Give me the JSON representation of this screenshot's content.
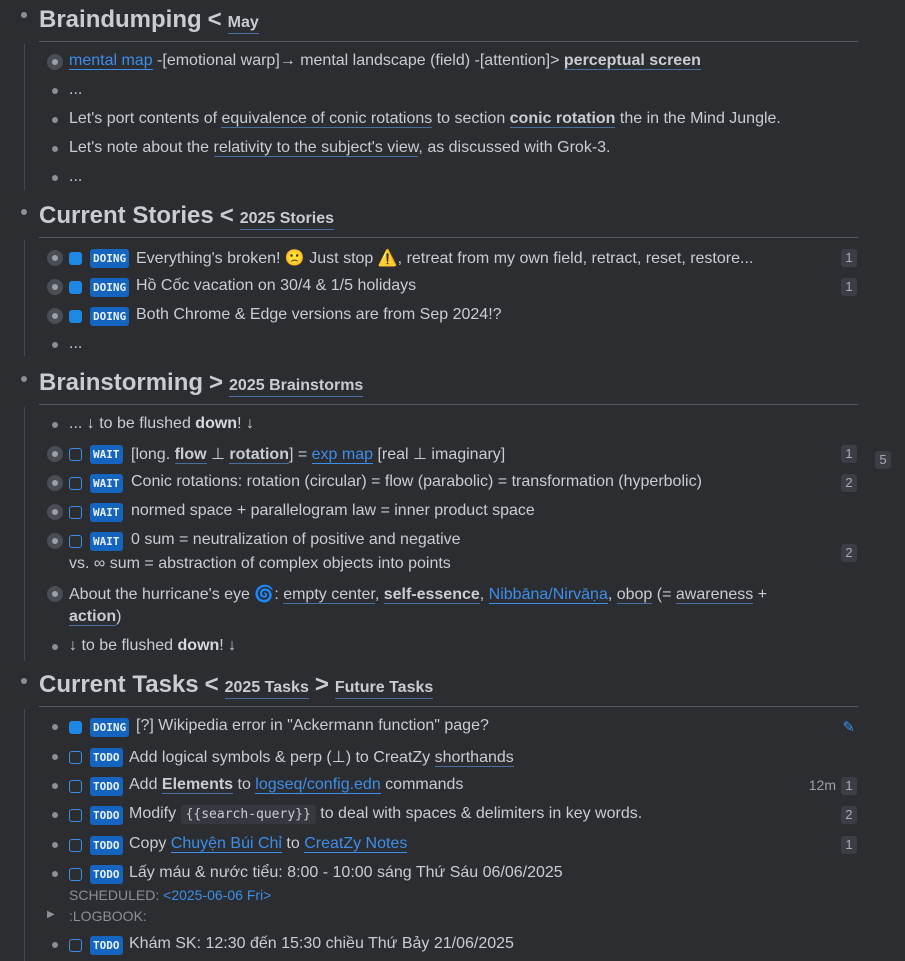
{
  "sections": {
    "braindump": {
      "title": "Braindumping",
      "sep": "<",
      "ref": "May",
      "items": {
        "i1": {
          "link": "mental map",
          "t1": " -[emotional warp]→ mental landscape (field) -[attention]> ",
          "b1": "perceptual screen"
        },
        "i2": {
          "text": "..."
        },
        "i3": {
          "t1": "Let's port contents of ",
          "link": "equivalence of conic rotations",
          "t2": " to section ",
          "b1": "conic rotation",
          "t3": " the in the Mind Jungle."
        },
        "i4": {
          "t1": "Let's note about the ",
          "link": "relativity to the subject's view",
          "t2": ", as discussed with Grok-3."
        },
        "i5": {
          "text": "..."
        }
      }
    },
    "stories": {
      "title": "Current Stories",
      "sep": "<",
      "ref": "2025 Stories",
      "items": [
        {
          "marker": "DOING",
          "text": "Everything's broken! 🙁 Just stop ⚠️, retreat from my own field, retract, reset, restore...",
          "count": "1"
        },
        {
          "marker": "DOING",
          "text": "Hồ Cốc vacation on 30/4 & 1/5 holidays",
          "count": "1"
        },
        {
          "marker": "DOING",
          "text": "Both Chrome & Edge versions are from Sep 2024!?",
          "count": ""
        },
        {
          "text": "..."
        }
      ]
    },
    "brainstorm": {
      "title": "Brainstorming",
      "sep": ">",
      "ref": "2025 Brainstorms",
      "side_count": "5",
      "items": {
        "flush1": {
          "t1": "... ↓ to be flushed ",
          "b1": "down",
          "t2": "! ↓"
        },
        "w1": {
          "marker": "WAIT",
          "t1": "[long. ",
          "b1": "flow",
          "t2": " ⊥ ",
          "b2": "rotation",
          "t3": "] = ",
          "link": "exp map",
          "t4": " [real ⊥ imaginary]",
          "count": "1"
        },
        "w2": {
          "marker": "WAIT",
          "text": "Conic rotations: rotation (circular) = flow (parabolic) = transformation (hyperbolic)",
          "count": "2"
        },
        "w3": {
          "marker": "WAIT",
          "text": "normed space + parallelogram law = inner product space"
        },
        "w4": {
          "marker": "WAIT",
          "line1": "0 sum = neutralization of positive and negative",
          "line2": "vs. ∞ sum = abstraction of complex objects into points",
          "count": "2"
        },
        "eye": {
          "t1": "About the hurricane's eye 🌀: ",
          "p1": "empty center",
          "c1": ", ",
          "p2": "self-essence",
          "c2": ", ",
          "link": "Nibbāna/Nirvāṇa",
          "c3": ", ",
          "p3": "obop",
          "t2": " (= ",
          "p4": "awareness",
          "t3": " +",
          "p5": "action",
          "t4": ")"
        },
        "flush2": {
          "t1": "↓ to be flushed ",
          "b1": "down",
          "t2": "! ↓"
        }
      }
    },
    "tasks": {
      "title": "Current Tasks",
      "sep": "<",
      "ref": "2025 Tasks",
      "sep2": ">",
      "ref2": "Future Tasks",
      "items": {
        "t1": {
          "marker": "DOING",
          "text": "[?] Wikipedia error in \"Ackermann function\" page?"
        },
        "t2": {
          "marker": "TODO",
          "t1": "Add logical symbols & perp (⊥) to CreatZy  ",
          "p1": "shorthands"
        },
        "t3": {
          "marker": "TODO",
          "t1": "Add ",
          "b1": "Elements",
          "t2": " to ",
          "link": "logseq/config.edn",
          "t3": " commands",
          "time": "12m",
          "count": "1"
        },
        "t4": {
          "marker": "TODO",
          "t1": "Modify ",
          "code": "{{search-query}}",
          "t2": " to deal with spaces & delimiters in key words.",
          "count": "2"
        },
        "t5": {
          "marker": "TODO",
          "t1": "Copy ",
          "link1": "Chuyện Búi Chỉ",
          "t2": " to  ",
          "link2": "CreatZy Notes",
          "count": "1"
        },
        "t6": {
          "marker": "TODO",
          "text": "Lấy máu & nước tiểu: 8:00 - 10:00 sáng Thứ Sáu 06/06/2025",
          "sched_label": "SCHEDULED: ",
          "sched_date": "<2025-06-06 Fri>",
          "logbook": ":LOGBOOK:"
        },
        "t7": {
          "marker": "TODO",
          "text": "Khám SK: 12:30 đến 15:30 chiều Thứ Bảy 21/06/2025"
        }
      }
    }
  },
  "colors": {
    "bg": "#2b2d31",
    "text": "#c9ccd1",
    "link": "#3d8ee8",
    "marker": "#1565c0"
  }
}
